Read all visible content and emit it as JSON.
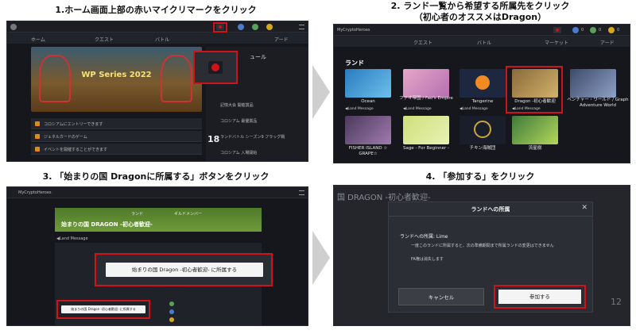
{
  "steps": {
    "s1": "1.ホーム画面上部の赤いマイクリマークをクリック",
    "s2_line1": "2. ランド一覧から希望する所属先をクリック",
    "s2_line2": "（初心者のオススメはDragon）",
    "s3": "3. 「始まりの国 Dragonに所属する」ボタンをクリック",
    "s4": "4. 「参加する」をクリック"
  },
  "p1": {
    "nav_home": "ホーム",
    "nav_quest": "クエスト",
    "nav_battle": "バトル",
    "nav_ard": "アード",
    "banner_text": "WP Series 2022",
    "side_title": "ュール",
    "rows": [
      "コロシアムにエントリーできます",
      "ジェネルカードのゲーム",
      "イベントを開催することができます"
    ],
    "date_num": "18",
    "side_items": [
      "コロシアム 最優賞品",
      "ランドバトル シーズン9 フラッグ戦",
      "記憶大会 開催賞品",
      "コロシアム 入場開始"
    ]
  },
  "p2": {
    "header_logo": "MyCryptoHeroes",
    "nav_quest": "クエスト",
    "nav_battle": "バトル",
    "nav_market": "マーケット",
    "nav_ard": "アード",
    "section_title": "ランド",
    "msg_label": "◀Land Message",
    "lands": [
      {
        "name": "Ocean"
      },
      {
        "name": "ファオ帝国 / Fao's Empire"
      },
      {
        "name": "Tangerine"
      },
      {
        "name": "Dragon -初心者歓迎"
      },
      {
        "name": "ベンチャー・ワールド / Graph Adventure World"
      },
      {
        "name": "FISHER ISLAND ☆ GRAPE☆"
      },
      {
        "name": "Sage - For Beginner -"
      },
      {
        "name": "チキン海賊団"
      },
      {
        "name": "流星樹"
      }
    ],
    "counts": [
      "0",
      "0",
      "0"
    ]
  },
  "p3": {
    "header_logo": "MyCryptoHeroes",
    "tab_land": "ランド",
    "tab_group": "ギルドメンバー",
    "land_banner": "始まりの国 DRAGON -初心者歓迎-",
    "land_message_label": "◀Land Message",
    "big_button": "始まりの国 Dragon -初心者歓迎- に所属する",
    "small_button": "始まりの国 Dragon -初心者歓迎- に所属する"
  },
  "p4": {
    "bg_title": "国 DRAGON -初心者歓迎-",
    "modal_title": "ランドへの所属",
    "belong_label": "ランドへの所属: Lime",
    "notes": [
      "一度このランドに所属すると、次の準備期間まで所属ランドの変更はできません",
      "FA権は消失します"
    ],
    "cancel": "キャンセル",
    "join": "参加する",
    "bg_num": "12"
  },
  "colors": {
    "accent_red": "#d0121b",
    "arrow": "#cfcfcf"
  }
}
